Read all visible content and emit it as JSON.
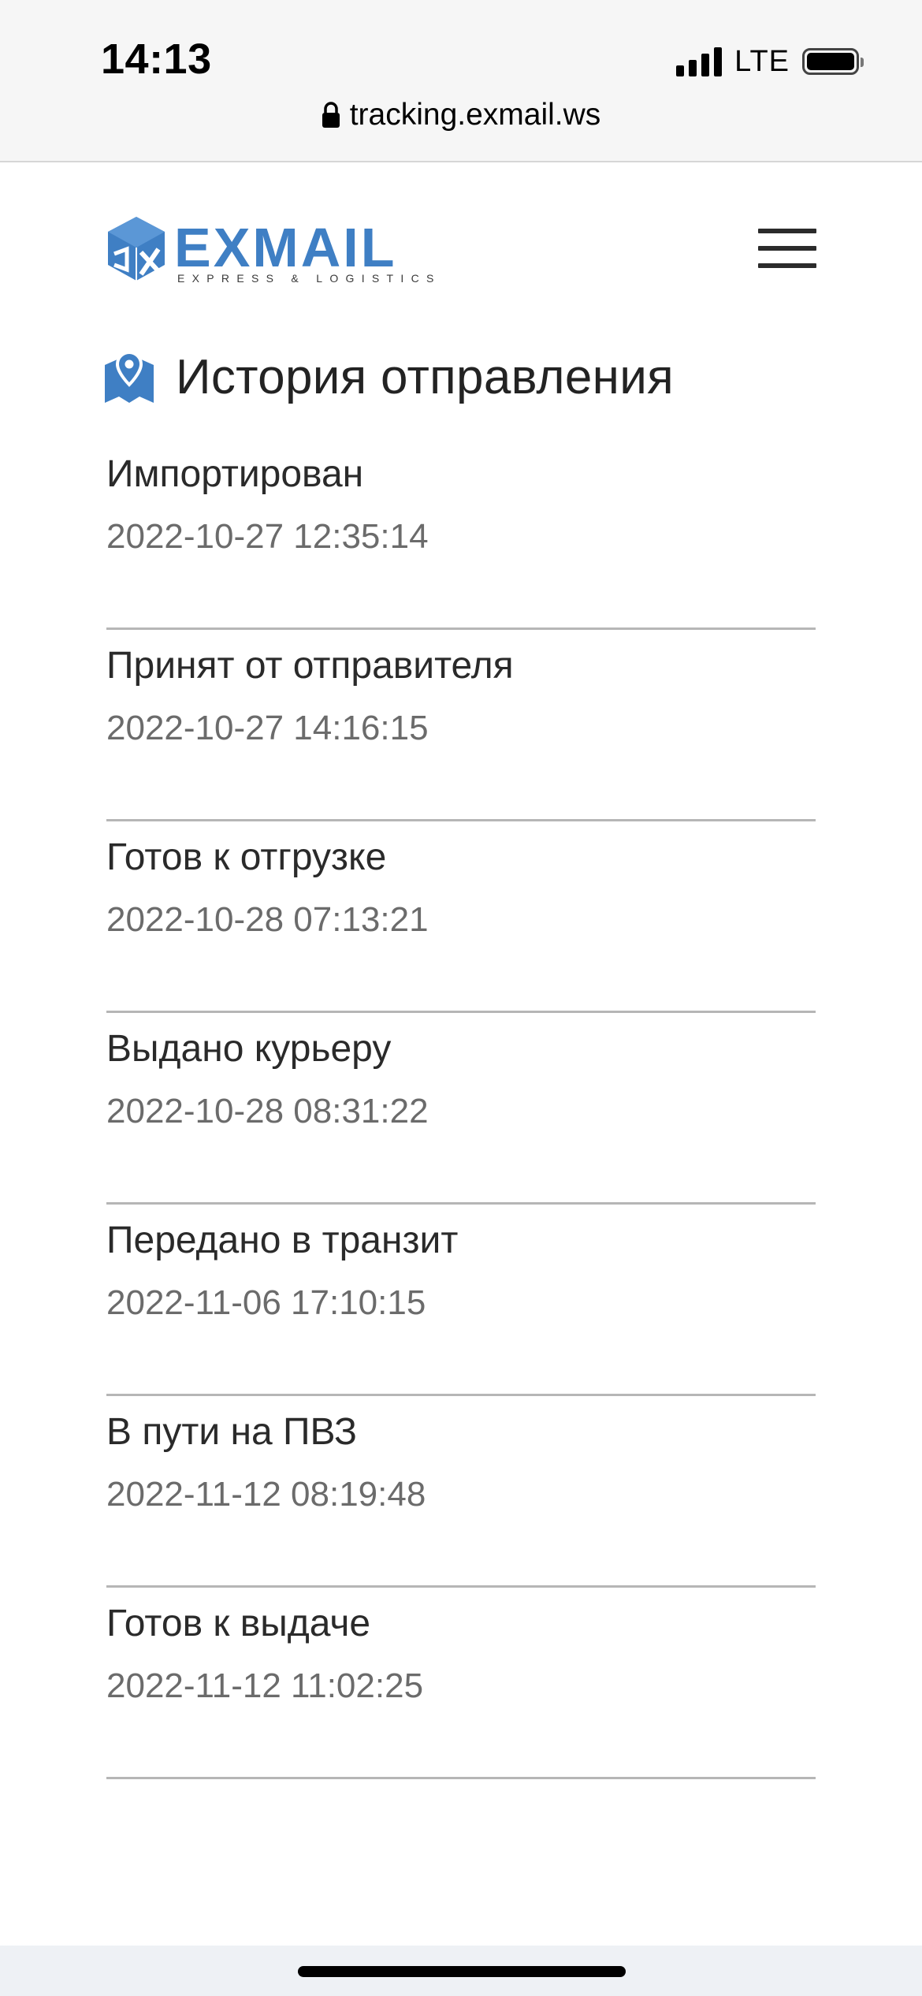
{
  "status_bar": {
    "time": "14:13",
    "network": "LTE",
    "signal_icon": "signal-bars-icon",
    "battery_icon": "battery-full-icon"
  },
  "browser": {
    "url": "tracking.exmail.ws",
    "lock_icon": "lock-icon"
  },
  "header": {
    "logo_name": "EXMAIL",
    "logo_tagline": "EXPRESS & LOGISTICS",
    "menu_icon": "hamburger-menu-icon",
    "brand_color": "#3f7fc4"
  },
  "history": {
    "title": "История отправления",
    "title_icon": "map-pin-icon",
    "events": [
      {
        "status": "Импортирован",
        "time": "2022-10-27 12:35:14"
      },
      {
        "status": "Принят от отправителя",
        "time": "2022-10-27 14:16:15"
      },
      {
        "status": "Готов к отгрузке",
        "time": "2022-10-28 07:13:21"
      },
      {
        "status": "Выдано курьеру",
        "time": "2022-10-28 08:31:22"
      },
      {
        "status": "Передано в транзит",
        "time": "2022-11-06 17:10:15"
      },
      {
        "status": "В пути на ПВЗ",
        "time": "2022-11-12 08:19:48"
      },
      {
        "status": "Готов к выдаче",
        "time": "2022-11-12 11:02:25"
      }
    ]
  }
}
